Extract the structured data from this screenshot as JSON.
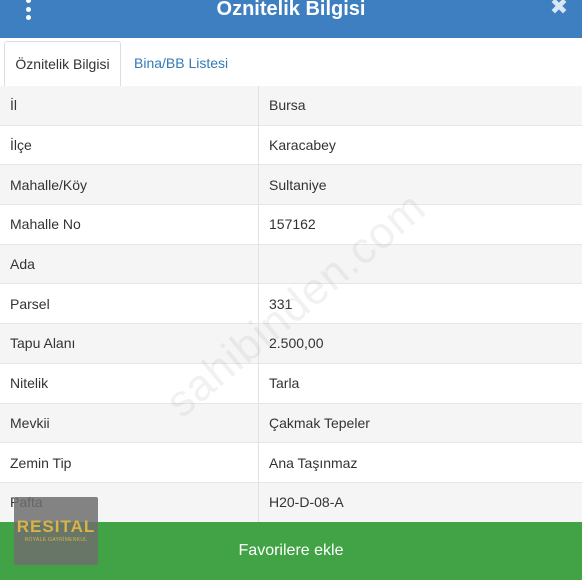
{
  "header": {
    "title": "Öznitelik Bilgisi",
    "menu_icon": "more-vertical-icon",
    "close_icon": "close-icon",
    "close_glyph": "✖"
  },
  "tabs": [
    {
      "label": "Öznitelik Bilgisi",
      "active": true
    },
    {
      "label": "Bina/BB Listesi",
      "active": false
    }
  ],
  "rows": [
    {
      "label": "İl",
      "value": "Bursa"
    },
    {
      "label": "İlçe",
      "value": "Karacabey"
    },
    {
      "label": "Mahalle/Köy",
      "value": "Sultaniye"
    },
    {
      "label": "Mahalle No",
      "value": "157162"
    },
    {
      "label": "Ada",
      "value": ""
    },
    {
      "label": "Parsel",
      "value": "331"
    },
    {
      "label": "Tapu Alanı",
      "value": "2.500,00"
    },
    {
      "label": "Nitelik",
      "value": "Tarla"
    },
    {
      "label": "Mevkii",
      "value": "Çakmak Tepeler"
    },
    {
      "label": "Zemin Tip",
      "value": "Ana Taşınmaz"
    },
    {
      "label": "Pafta",
      "value": "H20-D-08-A"
    }
  ],
  "watermark": "sahibinden.com",
  "logo": {
    "name": "RESITAL",
    "tagline": "ROYALE GAYRİMENKUL"
  },
  "footer": {
    "button_label": "Favorilere ekle"
  },
  "colors": {
    "header": "#3e7fc1",
    "favorite_button": "#42a346",
    "tab_link": "#337ab7"
  }
}
